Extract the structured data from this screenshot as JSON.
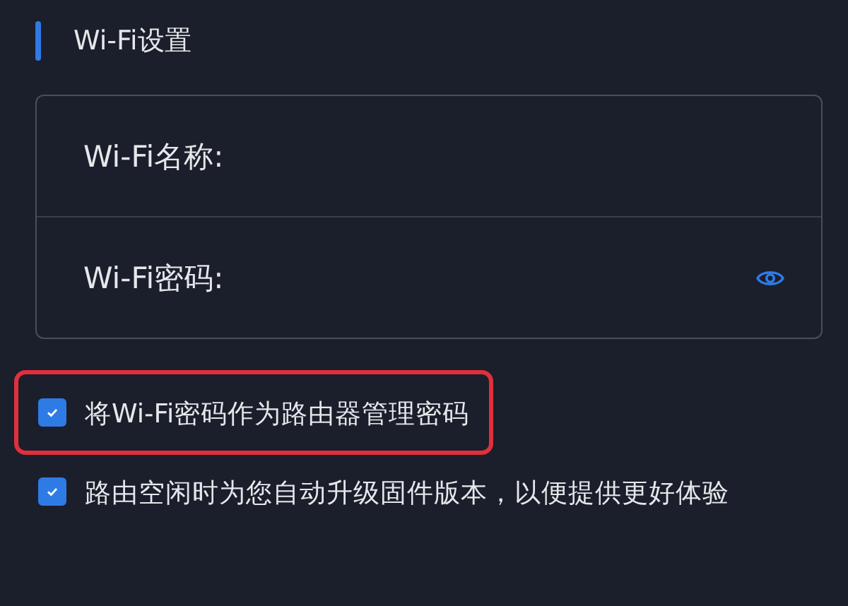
{
  "section": {
    "title": "Wi-Fi设置"
  },
  "fields": [
    {
      "label": "Wi-Fi名称:",
      "kind": "text"
    },
    {
      "label": "Wi-Fi密码:",
      "kind": "password"
    }
  ],
  "options": [
    {
      "label": "将Wi-Fi密码作为路由器管理密码",
      "checked": true,
      "highlighted": true
    },
    {
      "label": "路由空闲时为您自动升级固件版本，以便提供更好体验",
      "checked": true
    }
  ]
}
